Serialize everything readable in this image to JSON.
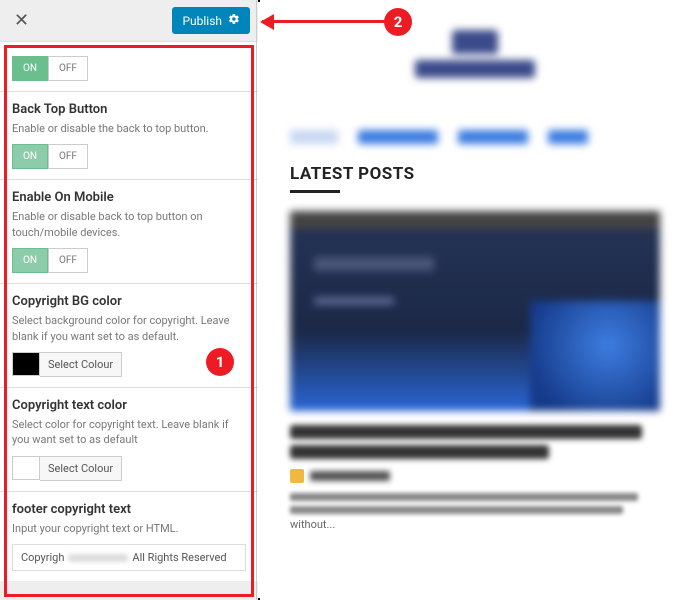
{
  "header": {
    "publish_label": "Publish"
  },
  "toggle": {
    "on": "ON",
    "off": "OFF"
  },
  "sections": {
    "back_top": {
      "title": "Back Top Button",
      "desc": "Enable or disable the back to top button."
    },
    "mobile": {
      "title": "Enable On Mobile",
      "desc": "Enable or disable back to top button on touch/mobile devices."
    },
    "bg_color": {
      "title": "Copyright BG color",
      "desc": "Select background color for copyright. Leave blank if you want set to as default.",
      "btn": "Select Colour"
    },
    "text_color": {
      "title": "Copyright text color",
      "desc": "Select color for copyright text. Leave blank if you want set to as default",
      "btn": "Select Colour"
    },
    "footer_text": {
      "title": "footer copyright text",
      "desc": "Input your copyright text or HTML.",
      "value_prefix": "Copyrigh",
      "value_suffix": "All Rights Reserved"
    }
  },
  "preview": {
    "latest_posts": "LATEST POSTS",
    "excerpt_tail": "without..."
  },
  "markers": {
    "one": "1",
    "two": "2"
  }
}
